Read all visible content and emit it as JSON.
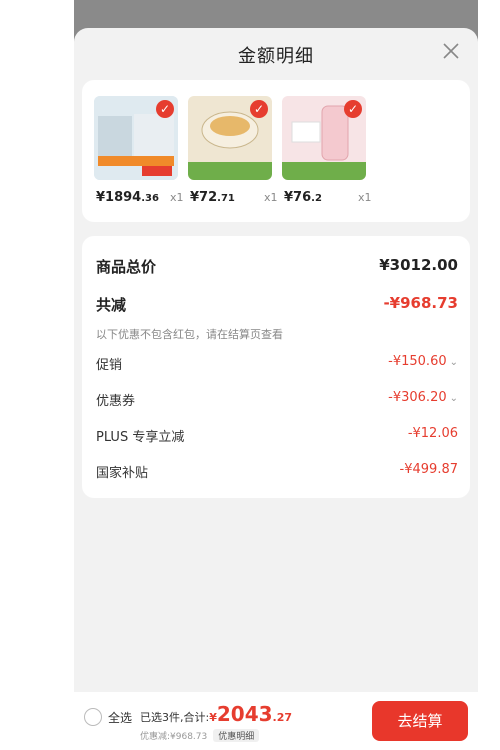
{
  "header": {
    "title": "金额明细"
  },
  "products": [
    {
      "price_main": "¥1894",
      "price_cents": ".36",
      "qty": "x1"
    },
    {
      "price_main": "¥72",
      "price_cents": ".71",
      "qty": "x1"
    },
    {
      "price_main": "¥76",
      "price_cents": ".2",
      "qty": "x1"
    }
  ],
  "breakdown": {
    "total_label": "商品总价",
    "total_value": "¥3012.00",
    "reduce_label": "共减",
    "reduce_value": "-¥968.73",
    "note": "以下优惠不包含红包，请在结算页查看",
    "items": [
      {
        "label": "促销",
        "value": "-¥150.60"
      },
      {
        "label": "优惠券",
        "value": "-¥306.20"
      },
      {
        "label": "PLUS 专享立减",
        "value": "-¥12.06"
      },
      {
        "label": "国家补贴",
        "value": "-¥499.87"
      }
    ]
  },
  "bottom": {
    "select_all": "全选",
    "summary_prefix": "已选3件,合计:",
    "currency": "¥",
    "amount": "2043",
    "cents": ".27",
    "discount_text": "优惠减:¥968.73",
    "detail_link": "优惠明细",
    "checkout_label": "去结算"
  },
  "colors": {
    "accent": "#e8372b",
    "price_red": "#e63d2f"
  },
  "icons": {
    "close": "close-icon",
    "check": "check-icon",
    "chevron": "chevron-down-icon"
  }
}
